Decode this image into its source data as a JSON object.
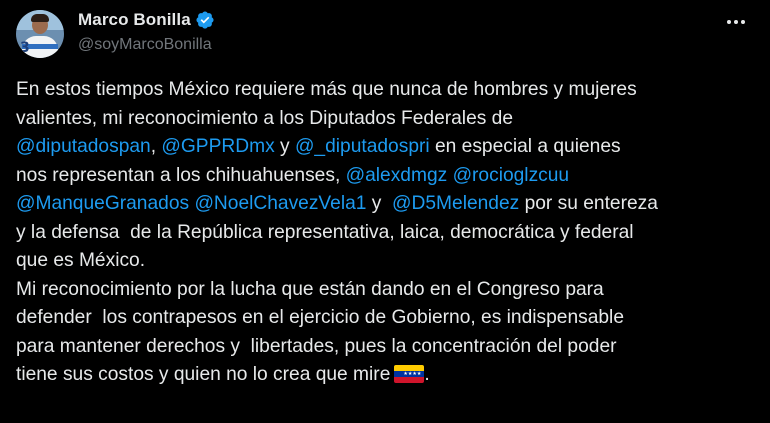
{
  "author": {
    "display_name": "Marco Bonilla",
    "handle": "@soyMarcoBonilla",
    "avatar_number": "3"
  },
  "icons": {
    "verified": "verified-badge-icon",
    "more": "more-options-icon",
    "flag": "venezuela-flag-emoji"
  },
  "colors": {
    "background": "#000000",
    "text": "#e7e9ea",
    "secondary_text": "#71767b",
    "mention": "#1d9bf0",
    "verified_badge": "#1d9bf0"
  },
  "tweet": {
    "l1": "En estos tiempos México requiere más que nunca de hombres y mujeres",
    "l2": "valientes, mi reconocimiento a los Diputados Federales de",
    "m_diputadospan": "@diputadospan",
    "sep_comma": ", ",
    "m_gpprdmx": "@GPPRDmx",
    "sep_y": " y ",
    "m_diputadospri": "@_diputadospri",
    "l3_tail": " en especial a quienes",
    "l4_head": "nos representan a los chihuahuenses, ",
    "m_alexdmgz": "@alexdmgz",
    "space": " ",
    "m_rocioglzcuu": "@rocioglzcuu",
    "m_manquegranados": "@ManqueGranados",
    "m_noelchavezvela1": "@NoelChavezVela1",
    "sep_y2": " y  ",
    "m_d5melendez": "@D5Melendez",
    "l5_tail": " por su entereza",
    "l6": "y la defensa  de la República representativa, laica, democrática y federal",
    "l7": "que es México.",
    "l8": "Mi reconocimiento por la lucha que están dando en el Congreso para",
    "l9": "defender  los contrapesos en el ejercicio de Gobierno, es indispensable",
    "l10": "para mantener derechos y  libertades, pues la concentración del poder",
    "l11": "tiene sus costos y quien no lo crea que mire",
    "l11_end": "."
  }
}
